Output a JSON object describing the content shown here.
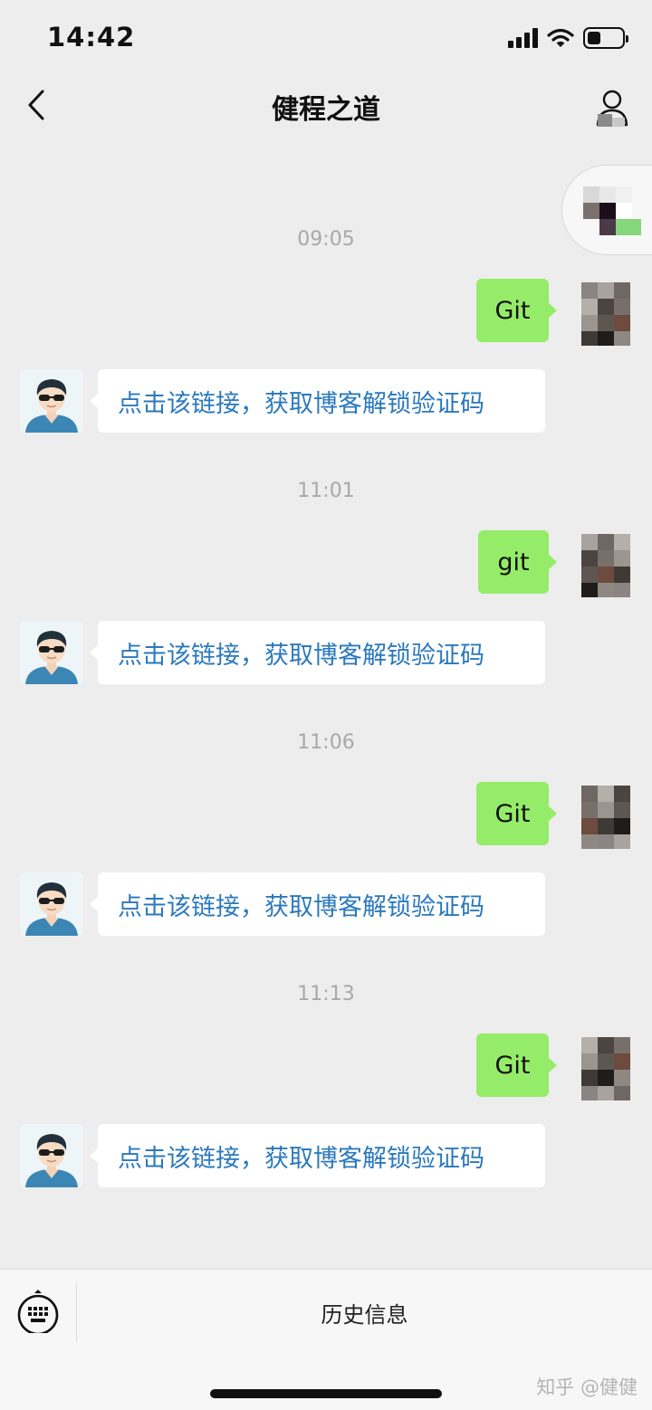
{
  "status_bar": {
    "time": "14:42"
  },
  "header": {
    "title": "健程之道"
  },
  "chat": {
    "messages": [
      {
        "timestamp": "09:05",
        "sent": "Git",
        "reply": "点击该链接，获取博客解锁验证码"
      },
      {
        "timestamp": "11:01",
        "sent": "git",
        "reply": "点击该链接，获取博客解锁验证码"
      },
      {
        "timestamp": "11:06",
        "sent": "Git",
        "reply": "点击该链接，获取博客解锁验证码"
      },
      {
        "timestamp": "11:13",
        "sent": "Git",
        "reply": "点击该链接，获取博客解锁验证码"
      }
    ]
  },
  "bottom_bar": {
    "history_label": "历史信息"
  },
  "watermark": "知乎 @健健",
  "colors": {
    "background": "#ededed",
    "sent_bubble": "#95ec69",
    "received_bubble": "#ffffff",
    "link_text": "#2b79bd",
    "timestamp_text": "#a9a9a9"
  },
  "icons": [
    "back-chevron-icon",
    "profile-icon",
    "signal-icon",
    "wifi-icon",
    "battery-icon",
    "keyboard-icon",
    "cartoon-avatar-icon"
  ]
}
